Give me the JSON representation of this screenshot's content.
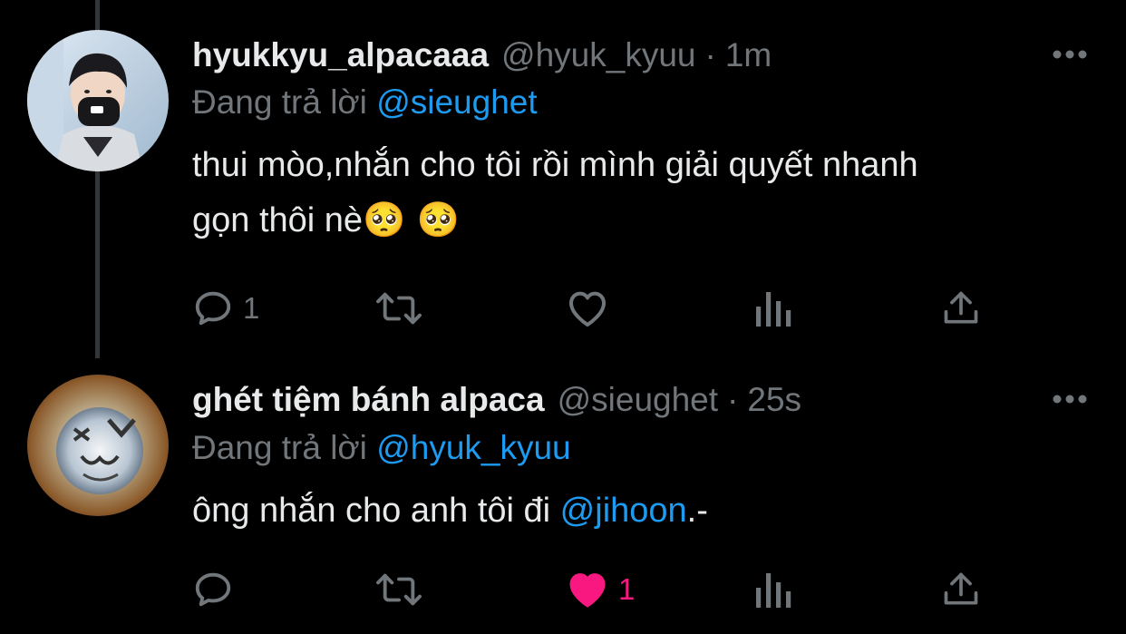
{
  "tweets": [
    {
      "display_name": "hyukkyu_alpacaaa",
      "handle": "@hyuk_kyuu",
      "separator": "·",
      "time": "1m",
      "reply_prefix": "Đang trả lời",
      "reply_to": "@sieughet",
      "text_line1": "thui mòo,nhắn cho tôi rồi mình giải quyết nhanh",
      "text_line2": "gọn thôi nè",
      "text_emoji": "🥺 🥺",
      "reply_count": "1",
      "like_count": "",
      "liked": false
    },
    {
      "display_name": "ghét tiệm bánh alpaca",
      "handle": "@sieughet",
      "separator": "·",
      "time": "25s",
      "reply_prefix": "Đang trả lời",
      "reply_to": "@hyuk_kyuu",
      "text_before": "ông nhắn cho anh tôi đi ",
      "text_mention": "@jihoon",
      "text_after": ".-",
      "reply_count": "",
      "like_count": "1",
      "liked": true
    }
  ],
  "colors": {
    "background": "#000000",
    "text": "#e7e9ea",
    "muted": "#71767b",
    "link": "#1d9bf0",
    "like": "#f91880",
    "thread_line": "#333639"
  },
  "icons": [
    "reply-icon",
    "retweet-icon",
    "like-icon",
    "views-icon",
    "share-icon",
    "more-icon"
  ]
}
